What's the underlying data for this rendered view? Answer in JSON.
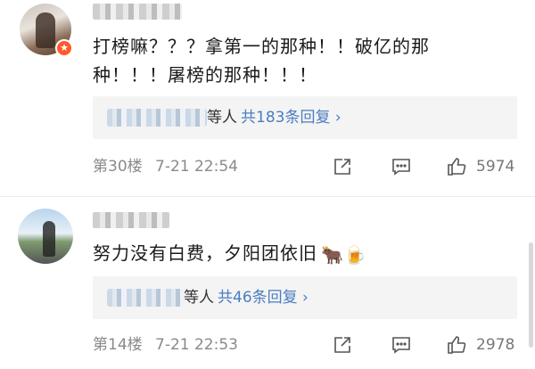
{
  "comments": [
    {
      "text": "打榜嘛？？？拿第一的那种！！破亿的那种！！！屠榜的那种！！！",
      "reply_suffix": "等人",
      "reply_link": "共183条回复 ›",
      "floor": "第30楼",
      "time": "7-21 22:54",
      "likes": "5974",
      "badge_icon": "medal-icon"
    },
    {
      "text": "努力没有白费，夕阳团依旧",
      "emoji": "🐂🍺",
      "reply_suffix": "等人",
      "reply_link": "共46条回复 ›",
      "floor": "第14楼",
      "time": "7-21 22:53",
      "likes": "2978"
    }
  ],
  "icons": {
    "share": "share-icon",
    "comment": "comment-icon",
    "like": "thumbs-up-icon"
  },
  "colors": {
    "link": "#4b7cc2",
    "badge": "#ff5a2b",
    "reply_bg": "#f4f4f4",
    "meta": "#8a8a8a"
  }
}
